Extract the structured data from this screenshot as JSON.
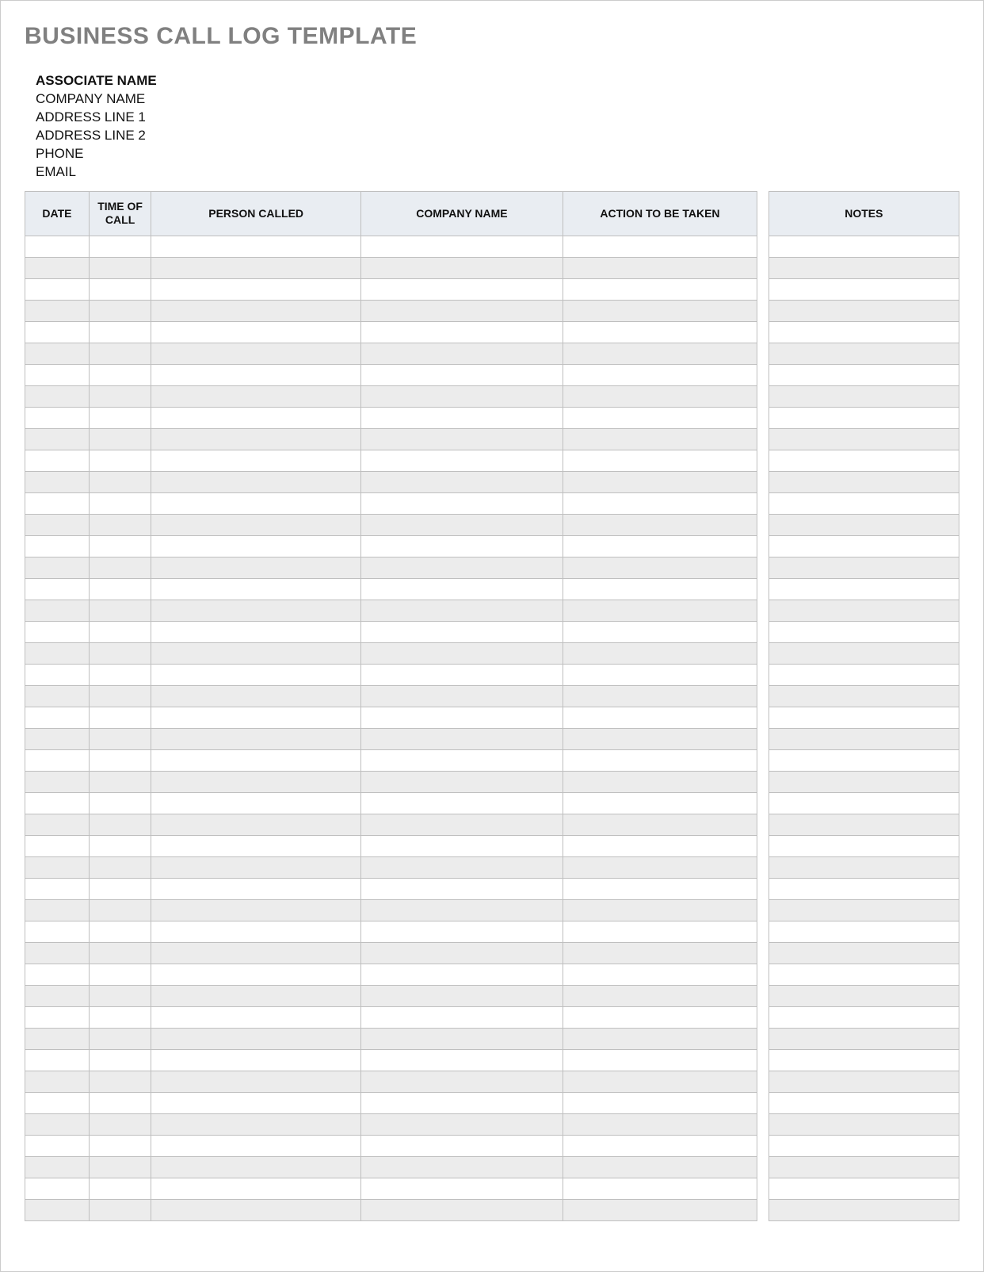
{
  "title": "BUSINESS CALL LOG TEMPLATE",
  "info": {
    "associate": "ASSOCIATE NAME",
    "company": "COMPANY NAME",
    "address1": "ADDRESS LINE 1",
    "address2": "ADDRESS LINE 2",
    "phone": "PHONE",
    "email": "EMAIL"
  },
  "columns": {
    "date": "DATE",
    "time": "TIME OF CALL",
    "person": "PERSON CALLED",
    "company": "COMPANY NAME",
    "action": "ACTION TO BE TAKEN",
    "notes": "NOTES"
  },
  "row_count": 46
}
